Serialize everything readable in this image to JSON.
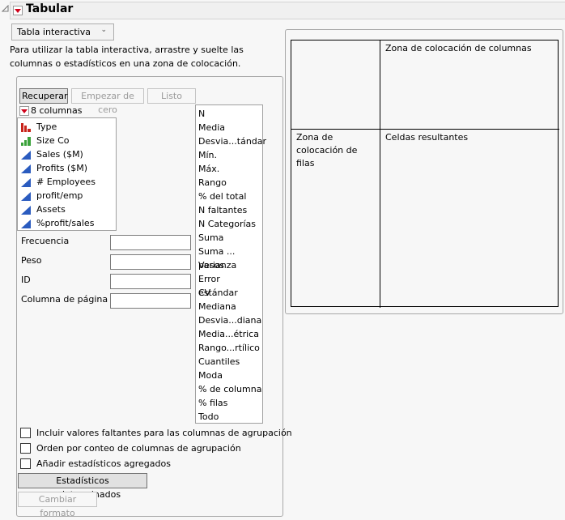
{
  "header": {
    "title": "Tabular",
    "collapse_icon": "disclosure-triangle-icon",
    "menu_icon": "red-triangle-menu-icon"
  },
  "mode_select": {
    "value": "Tabla interactiva",
    "icon": "chevron-down-icon"
  },
  "instructions": "Para utilizar la tabla interactiva, arrastre y suelte las columnas o estadísticos en una zona de colocación.",
  "buttons": {
    "recuperar": "Recuperar",
    "empezar": "Empezar de cero",
    "listo": "Listo",
    "defaults": "Estadísticos predeterminados",
    "change_format": "Cambiar formato"
  },
  "columns_header": "8 columnas",
  "columns": [
    {
      "name": "Type",
      "icon": "nominal-bar-icon",
      "color": "#c8241b"
    },
    {
      "name": "Size Co",
      "icon": "ordinal-bar-icon",
      "color": "#3aa23a"
    },
    {
      "name": "Sales ($M)",
      "icon": "continuous-ramp-icon",
      "color": "#2a5bbf"
    },
    {
      "name": "Profits ($M)",
      "icon": "continuous-ramp-icon",
      "color": "#2a5bbf"
    },
    {
      "name": "# Employees",
      "icon": "continuous-ramp-icon",
      "color": "#2a5bbf"
    },
    {
      "name": "profit/emp",
      "icon": "continuous-ramp-icon",
      "color": "#2a5bbf"
    },
    {
      "name": "Assets",
      "icon": "continuous-ramp-icon",
      "color": "#2a5bbf"
    },
    {
      "name": "%profit/sales",
      "icon": "continuous-ramp-icon",
      "color": "#2a5bbf"
    }
  ],
  "statistics": [
    "N",
    "Media",
    "Desvia...tándar",
    "Mín.",
    "Máx.",
    "Rango",
    "% del total",
    "N faltantes",
    "N Categorías",
    "Suma",
    "Suma ... pesos",
    "Varianza",
    "Error estándar",
    "CV",
    "Mediana",
    "Desvia...diana",
    "Media...étrica",
    "Rango...rtílico",
    "Cuantiles",
    "Moda",
    "% de columna",
    "% filas",
    "Todo"
  ],
  "fields": [
    {
      "label": "Frecuencia",
      "value": ""
    },
    {
      "label": "Peso",
      "value": ""
    },
    {
      "label": "ID",
      "value": ""
    },
    {
      "label": "Columna de página",
      "value": ""
    }
  ],
  "checkboxes": [
    {
      "label": "Incluir valores faltantes para las columnas de agrupación",
      "checked": false
    },
    {
      "label": "Orden por conteo de columnas de agrupación",
      "checked": false
    },
    {
      "label": "Añadir estadísticos agregados",
      "checked": false
    }
  ],
  "drop_zones": {
    "columns": "Zona de colocación de columnas",
    "rows_line1": "Zona de",
    "rows_line2": "colocación de",
    "rows_line3": "filas",
    "cells": "Celdas resultantes"
  }
}
